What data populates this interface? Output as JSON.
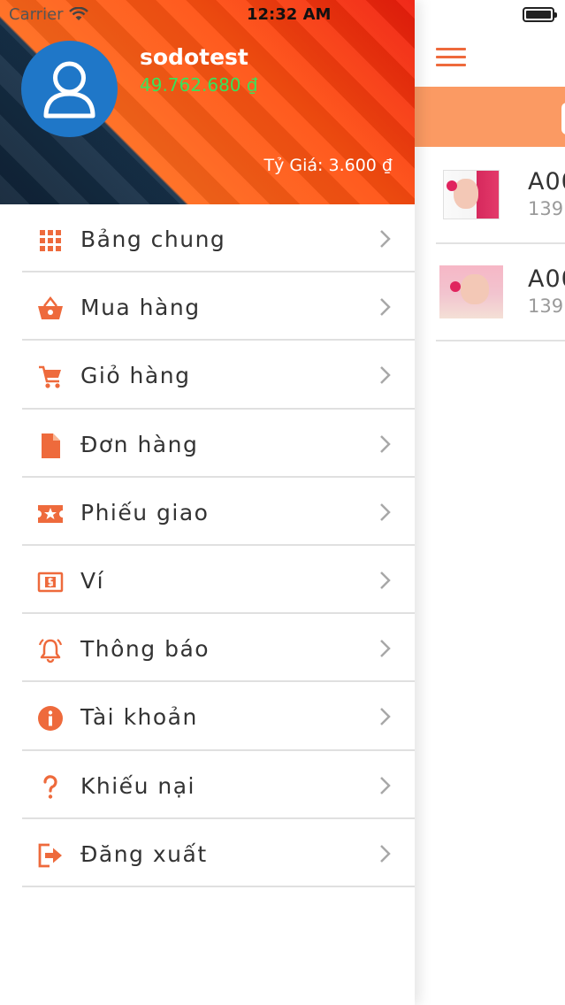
{
  "status_bar": {
    "carrier": "Carrier",
    "time": "12:32 AM"
  },
  "drawer": {
    "username": "sodotest",
    "balance": "49.762.680 ₫",
    "exchange_rate": "Tỷ Giá: 3.600 ₫",
    "menu": [
      {
        "label": "Bảng chung",
        "icon": "grid-icon"
      },
      {
        "label": "Mua hàng",
        "icon": "basket-icon"
      },
      {
        "label": "Giỏ hàng",
        "icon": "cart-icon"
      },
      {
        "label": "Đơn hàng",
        "icon": "document-icon"
      },
      {
        "label": "Phiếu giao",
        "icon": "ticket-star-icon"
      },
      {
        "label": "Ví",
        "icon": "wallet-dollar-icon"
      },
      {
        "label": "Thông báo",
        "icon": "alarm-bell-icon"
      },
      {
        "label": "Tài khoản",
        "icon": "info-icon"
      },
      {
        "label": "Khiếu nại",
        "icon": "question-icon"
      },
      {
        "label": "Đăng xuất",
        "icon": "logout-icon"
      }
    ]
  },
  "content": {
    "products": [
      {
        "code": "A00",
        "price": "139."
      },
      {
        "code": "A00",
        "price": "139."
      }
    ]
  },
  "colors": {
    "accent": "#ee6a3c",
    "band": "#fb9a63",
    "balance": "#39e35a",
    "avatar": "#1f77c8"
  }
}
